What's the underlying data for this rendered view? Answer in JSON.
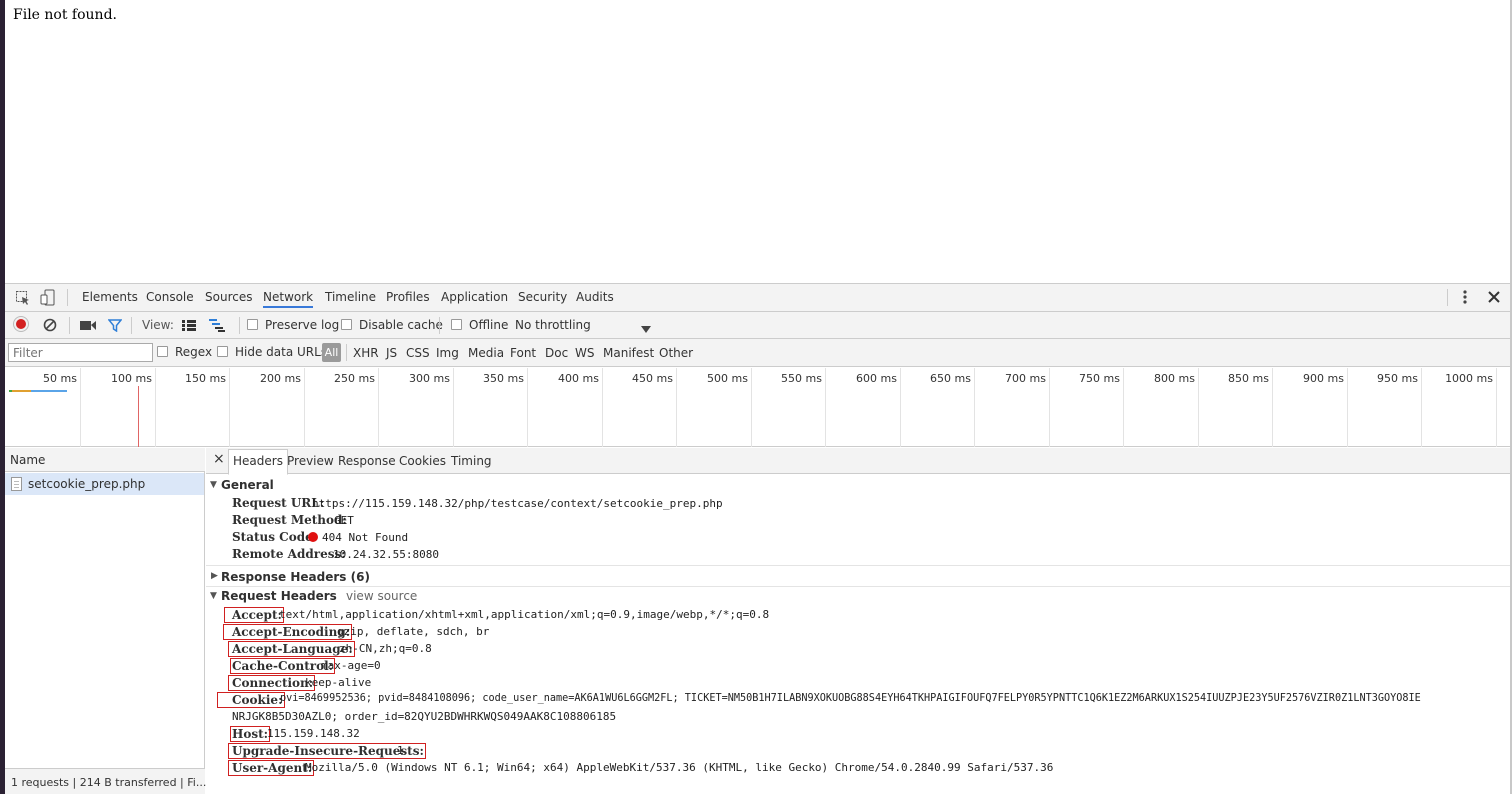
{
  "page": {
    "message": "File not found."
  },
  "devtools": {
    "tabs": [
      "Elements",
      "Console",
      "Sources",
      "Network",
      "Timeline",
      "Profiles",
      "Application",
      "Security",
      "Audits"
    ],
    "active_tab": "Network",
    "toolbar": {
      "view_label": "View:",
      "preserve_log": "Preserve log",
      "disable_cache": "Disable cache",
      "offline": "Offline",
      "throttling": "No throttling"
    },
    "filter": {
      "placeholder": "Filter",
      "regex": "Regex",
      "hide_data_urls": "Hide data URLs",
      "types": [
        "All",
        "XHR",
        "JS",
        "CSS",
        "Img",
        "Media",
        "Font",
        "Doc",
        "WS",
        "Manifest",
        "Other"
      ]
    },
    "timeline_ticks": [
      "50 ms",
      "100 ms",
      "150 ms",
      "200 ms",
      "250 ms",
      "300 ms",
      "350 ms",
      "400 ms",
      "450 ms",
      "500 ms",
      "550 ms",
      "600 ms",
      "650 ms",
      "700 ms",
      "750 ms",
      "800 ms",
      "850 ms",
      "900 ms",
      "950 ms",
      "1000 ms"
    ],
    "name_panel": {
      "header": "Name",
      "rows": [
        "setcookie_prep.php"
      ],
      "status": "1 requests | 214 B transferred | Fi..."
    },
    "detail": {
      "close": "×",
      "tabs": [
        "Headers",
        "Preview",
        "Response",
        "Cookies",
        "Timing"
      ],
      "active_tab": "Headers",
      "general": {
        "title": "General",
        "rows": [
          {
            "name": "Request URL:",
            "value": "https://115.159.148.32/php/testcase/context/setcookie_prep.php"
          },
          {
            "name": "Request Method:",
            "value": "GET"
          },
          {
            "name": "Status Code:",
            "value": "404 Not Found"
          },
          {
            "name": "Remote Address:",
            "value": "10.24.32.55:8080"
          }
        ]
      },
      "response_headers": {
        "title": "Response Headers (6)"
      },
      "request_headers": {
        "title": "Request Headers",
        "view_source": "view source",
        "rows": [
          {
            "name": "Accept:",
            "value": "text/html,application/xhtml+xml,application/xml;q=0.9,image/webp,*/*;q=0.8"
          },
          {
            "name": "Accept-Encoding:",
            "value": "gzip, deflate, sdch, br"
          },
          {
            "name": "Accept-Language:",
            "value": "zh-CN,zh;q=0.8"
          },
          {
            "name": "Cache-Control:",
            "value": "max-age=0"
          },
          {
            "name": "Connection:",
            "value": "keep-alive"
          },
          {
            "name": "Cookie:",
            "value": "pvi=8469952536; pvid=8484108096; code_user_name=AK6A1WU6L6GGM2FL; TICKET=NM50B1H7ILABN9XOKUOBG88S4EYH64TKHPAIGIFOUFQ7FELPY0R5YPNTTC1Q6K1EZ2M6ARKUX1S254IUUZPJE23Y5UF2576VZIR0Z1LNT3GOYO8IE"
          },
          {
            "name": "",
            "value": "NRJGK8B5D30AZL0; order_id=82QYU2BDWHRKWQS049AAK8C108806185"
          },
          {
            "name": "Host:",
            "value": "115.159.148.32"
          },
          {
            "name": "Upgrade-Insecure-Requests:",
            "value": "1"
          },
          {
            "name": "User-Agent:",
            "value": "Mozilla/5.0 (Windows NT 6.1; Win64; x64) AppleWebKit/537.36 (KHTML, like Gecko) Chrome/54.0.2840.99 Safari/537.36"
          }
        ]
      }
    }
  }
}
